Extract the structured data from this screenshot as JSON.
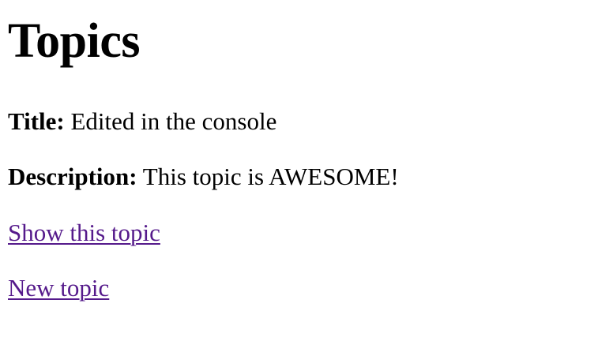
{
  "page": {
    "heading": "Topics"
  },
  "topic": {
    "title_label": "Title:",
    "title_value": "Edited in the console",
    "description_label": "Description:",
    "description_value": "This topic is AWESOME!"
  },
  "links": {
    "show": "Show this topic",
    "new": "New topic"
  },
  "colors": {
    "text": "#000000",
    "visited_link": "#551a8b",
    "background": "#ffffff"
  }
}
